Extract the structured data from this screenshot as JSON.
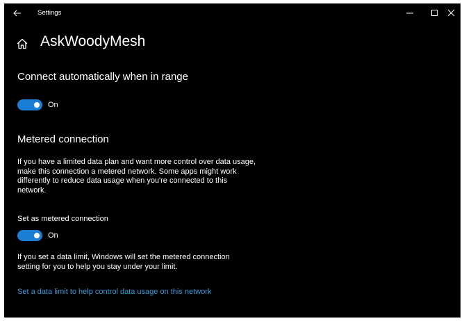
{
  "window": {
    "title": "Settings",
    "controls": [
      "minimize-icon",
      "maximize-icon",
      "close-icon"
    ]
  },
  "header": {
    "title": "AskWoodyMesh"
  },
  "connect": {
    "heading": "Connect automatically when in range",
    "toggle_state": "On"
  },
  "metered": {
    "heading": "Metered connection",
    "description": "If you have a limited data plan and want more control over data usage, make this connection a metered network. Some apps might work differently to reduce data usage when you're connected to this network.",
    "setting_label": "Set as metered connection",
    "toggle_state": "On",
    "limit_note": "If you set a data limit, Windows will set the metered connection setting for you to help you stay under your limit.",
    "link": "Set a data limit to help control data usage on this network"
  },
  "colors": {
    "background": "#000000",
    "accent": "#1a7fd4",
    "link": "#3a9ad9",
    "text": "#ffffff"
  }
}
